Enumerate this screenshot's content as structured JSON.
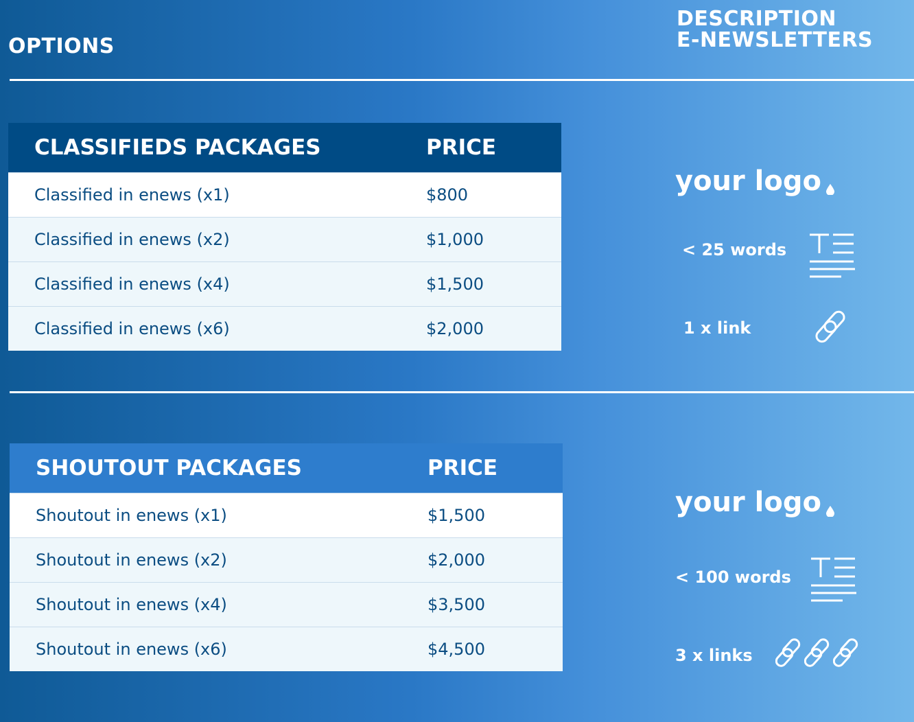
{
  "header": {
    "options_label": "OPTIONS",
    "description_label": "DESCRIPTION",
    "enewsletters_label": "E-NEWSLETTERS"
  },
  "classifieds": {
    "col_package": "CLASSIFIEDS PACKAGES",
    "col_price": "PRICE",
    "header_color": "#004b85",
    "rows": [
      {
        "name": "Classified in enews (x1)",
        "price": "$800"
      },
      {
        "name": "Classified in enews (x2)",
        "price": "$1,000"
      },
      {
        "name": "Classified in enews (x4)",
        "price": "$1,500"
      },
      {
        "name": "Classified in enews (x6)",
        "price": "$2,000"
      }
    ],
    "description": {
      "logo_text": "your logo",
      "words_label": "< 25 words",
      "words_icon": "text-lines-icon",
      "links_label": "1 x link",
      "link_icon": "link-icon",
      "link_count": 1
    }
  },
  "shoutout": {
    "col_package": "SHOUTOUT PACKAGES",
    "col_price": "PRICE",
    "header_color": "#2e7dcd",
    "rows": [
      {
        "name": "Shoutout in enews (x1)",
        "price": "$1,500"
      },
      {
        "name": "Shoutout in enews (x2)",
        "price": "$2,000"
      },
      {
        "name": "Shoutout in enews (x4)",
        "price": "$3,500"
      },
      {
        "name": "Shoutout in enews (x6)",
        "price": "$4,500"
      }
    ],
    "description": {
      "logo_text": "your logo",
      "words_label": "< 100 words",
      "words_icon": "text-lines-icon",
      "links_label": "3 x links",
      "link_icon": "link-icon",
      "link_count": 3
    }
  }
}
